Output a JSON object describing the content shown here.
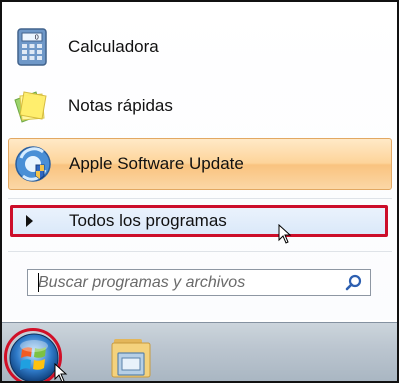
{
  "start_menu": {
    "pinned_programs": [
      {
        "label": "Calculadora",
        "icon": "calculator-icon"
      },
      {
        "label": "Notas rápidas",
        "icon": "sticky-notes-icon"
      },
      {
        "label": "Apple Software Update",
        "icon": "apple-software-update-icon"
      }
    ],
    "all_programs": {
      "label": "Todos los programas",
      "icon": "triangle-right-icon"
    },
    "search": {
      "placeholder": "Buscar programas y archivos",
      "value": "",
      "icon": "magnifier-icon"
    }
  },
  "taskbar": {
    "items": [
      {
        "icon": "windows-start-orb-icon"
      },
      {
        "icon": "file-explorer-folder-icon"
      }
    ]
  },
  "colors": {
    "annotation_red": "#cc0e2a",
    "highlight_orange": "#fdd49a",
    "hover_blue": "#dbe9fa",
    "taskbar": "#bcc6d0"
  }
}
